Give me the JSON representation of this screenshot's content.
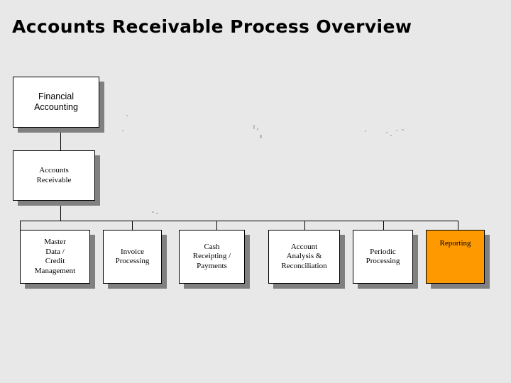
{
  "slide": {
    "title": "Accounts Receivable Process Overview",
    "background_color": "#E8E8E8",
    "highlight_color": "#FF9900",
    "shadow_color": "#808080",
    "box_fill_color": "#FFFFFF",
    "border_color": "#000000"
  },
  "diagram": {
    "levels": [
      {
        "name": "level-1",
        "nodes": [
          {
            "id": "financial-accounting",
            "label": "Financial\nAccounting",
            "highlighted": false
          }
        ]
      },
      {
        "name": "level-2",
        "nodes": [
          {
            "id": "accounts-receivable",
            "label": "Accounts\nReceivable",
            "highlighted": false
          }
        ]
      },
      {
        "name": "level-3",
        "nodes": [
          {
            "id": "master-data-credit-management",
            "label": "Master\nData /\nCredit\nManagement",
            "highlighted": false
          },
          {
            "id": "invoice-processing",
            "label": "Invoice\nProcessing",
            "highlighted": false
          },
          {
            "id": "cash-receipting-payments",
            "label": "Cash\nReceipting /\nPayments",
            "highlighted": false
          },
          {
            "id": "account-analysis-reconciliation",
            "label": "Account\nAnalysis &\nReconciliation",
            "highlighted": false
          },
          {
            "id": "periodic-processing",
            "label": "Periodic\nProcessing",
            "highlighted": false
          },
          {
            "id": "reporting",
            "label": "Reporting",
            "highlighted": true
          }
        ]
      }
    ]
  }
}
